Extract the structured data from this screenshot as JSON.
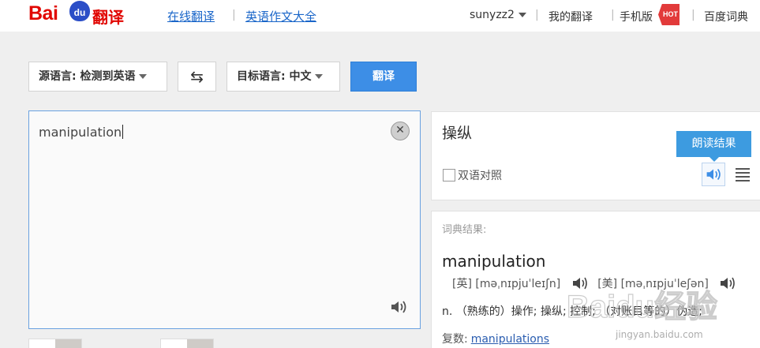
{
  "header": {
    "logo": {
      "bai": "Bai",
      "du": "du",
      "fanyi": "翻译"
    },
    "nav": [
      {
        "label": "在线翻译"
      },
      {
        "label": "英语作文大全"
      }
    ],
    "user": "sunyzz2",
    "my_translate": "我的翻译",
    "mobile": "手机版",
    "hot": "HOT",
    "dict": "百度词典"
  },
  "controls": {
    "source_lang": "源语言: 检测到英语",
    "target_lang": "目标语言: 中文",
    "swap_glyph": "⇆",
    "translate_label": "翻译"
  },
  "source": {
    "text": "manipulation",
    "clear_glyph": "✕"
  },
  "result": {
    "text": "操纵",
    "bilingual_label": "双语对照",
    "tooltip": "朗读结果"
  },
  "dictionary": {
    "heading": "词典结果:",
    "word": "manipulation",
    "uk_label": "[英]",
    "uk_phonetic": "[məˌnɪpjuˈleɪʃn]",
    "us_label": "[美]",
    "us_phonetic": "[məˌnɪpjuˈleʃən]",
    "definition": "n. （熟练的）操作; 操纵; 控制; （对账目等的）伪造;",
    "plural_label": "复数:",
    "plural_value": "manipulations"
  },
  "watermark": {
    "brand": "Baidu经验",
    "url": "jingyan.baidu.com"
  },
  "colors": {
    "brand_red": "#e10601",
    "brand_blue": "#2b4ec7",
    "accent": "#3d8ee6",
    "link": "#1a66c9"
  }
}
